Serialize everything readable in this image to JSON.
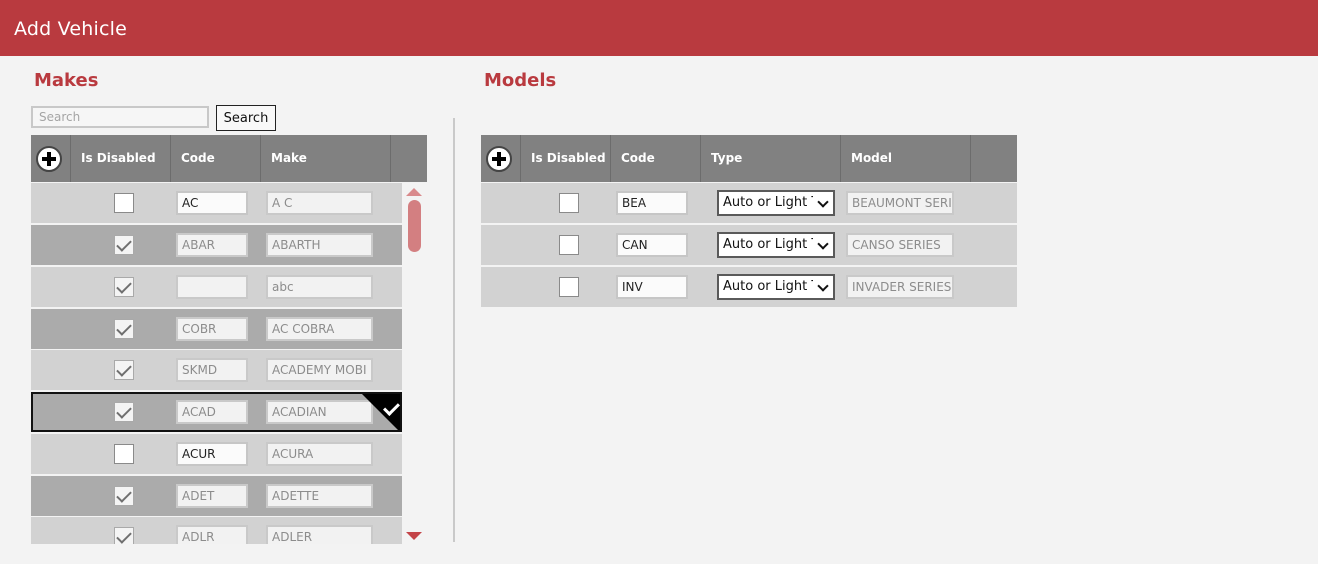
{
  "window": {
    "title": "Add Vehicle"
  },
  "makes": {
    "heading": "Makes",
    "search": {
      "placeholder": "Search",
      "value": "",
      "button_label": "Search"
    },
    "columns": [
      "Is Disabled",
      "Code",
      "Make"
    ],
    "rows": [
      {
        "disabled": false,
        "code": "AC",
        "make": "A C",
        "code_editable": true
      },
      {
        "disabled": true,
        "code": "ABAR",
        "make": "ABARTH",
        "code_editable": false
      },
      {
        "disabled": true,
        "code": "",
        "make": "abc",
        "code_editable": false
      },
      {
        "disabled": true,
        "code": "COBR",
        "make": "AC COBRA",
        "code_editable": false
      },
      {
        "disabled": true,
        "code": "SKMD",
        "make": "ACADEMY MOBI",
        "code_editable": false
      },
      {
        "disabled": true,
        "code": "ACAD",
        "make": "ACADIAN",
        "code_editable": false,
        "selected": true
      },
      {
        "disabled": false,
        "code": "ACUR",
        "make": "ACURA",
        "code_editable": true
      },
      {
        "disabled": true,
        "code": "ADET",
        "make": "ADETTE",
        "code_editable": false
      },
      {
        "disabled": true,
        "code": "ADLR",
        "make": "ADLER",
        "code_editable": false
      }
    ]
  },
  "models": {
    "heading": "Models",
    "columns": [
      "Is Disabled",
      "Code",
      "Type",
      "Model"
    ],
    "rows": [
      {
        "disabled": false,
        "code": "BEA",
        "type": "Auto or Light T",
        "model": "BEAUMONT SERI"
      },
      {
        "disabled": false,
        "code": "CAN",
        "type": "Auto or Light T",
        "model": "CANSO SERIES"
      },
      {
        "disabled": false,
        "code": "INV",
        "type": "Auto or Light T",
        "model": "INVADER SERIES"
      }
    ]
  },
  "icons": {
    "add": "plus-circle-icon",
    "selected": "checkmark-icon",
    "scroll_up": "arrow-up-icon",
    "scroll_down": "arrow-down-icon",
    "dropdown": "chevron-down-icon"
  },
  "colors": {
    "titlebar": "#b93a3f",
    "heading": "#b93a3f",
    "header_bg": "#818181",
    "row_light": "#d2d2d2",
    "row_dark": "#ababab",
    "scrollbar": "#d37f81"
  }
}
